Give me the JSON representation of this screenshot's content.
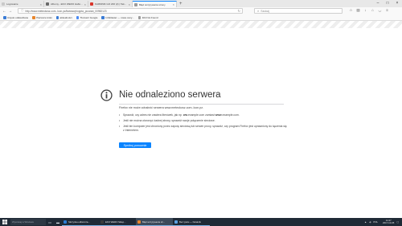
{
  "tabs": [
    {
      "label": "Logowanie",
      "color": "#c9c9c9",
      "active": false
    },
    {
      "label": "Albumy - EKO WERO Haftowane",
      "color": "#6a6a6a",
      "active": false
    },
    {
      "label": "KARMNIK GO 200 (2) | Tak...",
      "color": "#d9352b",
      "active": false
    },
    {
      "label": "Błąd wczytywania strony",
      "color": "#9b9b9b",
      "active": true
    }
  ],
  "url": {
    "text": "http://www.meteokosz.com..Icon.pz/ttwwsw/ploppta_pcocsst_00982123"
  },
  "search": {
    "placeholder": "Szukaj"
  },
  "bookmarks": [
    {
      "label": "Często odwiedzane",
      "color": "#3a7bd5"
    },
    {
      "label": "Pierwsze kroki",
      "color": "#e8852b"
    },
    {
      "label": "aktualności",
      "color": "#3a7bd5"
    },
    {
      "label": "Tłumacz Google",
      "color": "#4a8af4"
    },
    {
      "label": "Infoblaster — nowe ceny...",
      "color": "#3a7bd5"
    },
    {
      "label": "404 Not Found",
      "color": "#9b9b9b"
    }
  ],
  "error": {
    "title": "Nie odnaleziono serwera",
    "description": "Firefox nie może odnaleźć serwera www.meteokosz.com..Icon.pz.",
    "bullet1_pre": "Sprawdź, czy adres nie zawiera literówek, jak np. ",
    "bullet1_bold1": "ww",
    "bullet1_mid": ".example.com zamiast ",
    "bullet1_bold2": "www",
    "bullet1_post": ".example.com.",
    "bullet2": "Jeśli nie można otworzyć żadnej strony, sprawdź swoje połączenie sieciowe.",
    "bullet3": "Jeśli ten komputer jest chroniony przez zaporę sieciową lub serwer proxy, sprawdź, czy program Firefox jest uprawniony do łączenia się z Internetem.",
    "retry_label": "Spróbuj ponownie"
  },
  "taskbar": {
    "search_placeholder": "Wyszukaj w Windows",
    "apps": [
      {
        "label": "Skrzynka odbiorcza...",
        "color": "#2b7cd3",
        "active": false
      },
      {
        "label": "EKO WERO Sklep...",
        "color": "#3b3b3b",
        "active": false
      },
      {
        "label": "Błąd wczytywania str...",
        "color": "#e8852b",
        "active": true
      },
      {
        "label": "Bez tytułu — Notatnik",
        "color": "#5aa0e0",
        "active": false
      }
    ],
    "tray_lang": "POL",
    "time": "14:27",
    "date": "2017-10-05"
  }
}
